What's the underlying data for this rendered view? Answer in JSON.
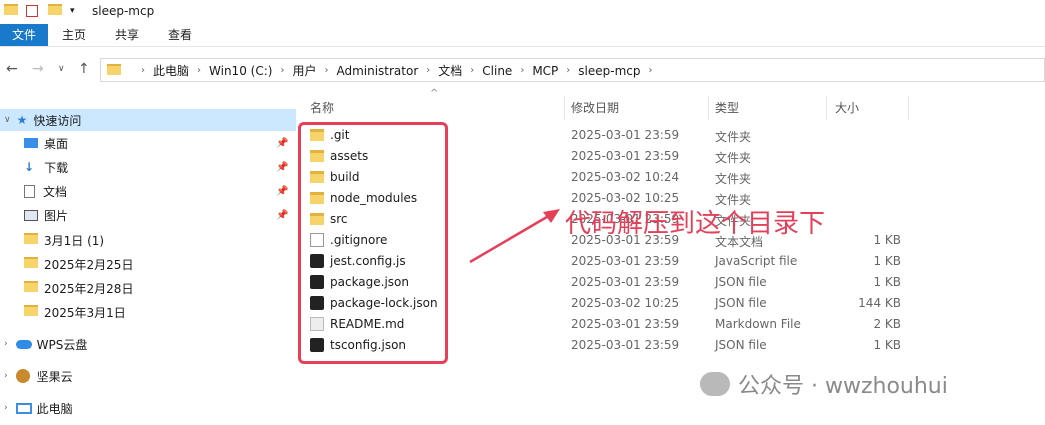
{
  "window": {
    "title": "sleep-mcp"
  },
  "ribbon": {
    "tabs": [
      "文件",
      "主页",
      "共享",
      "查看"
    ]
  },
  "address": {
    "crumbs": [
      "此电脑",
      "Win10 (C:)",
      "用户",
      "Administrator",
      "文档",
      "Cline",
      "MCP",
      "sleep-mcp"
    ]
  },
  "sidebar": {
    "items": [
      {
        "label": "快速访问",
        "icon": "star-icon"
      },
      {
        "label": "桌面",
        "icon": "desktop-icon",
        "pinned": true
      },
      {
        "label": "下载",
        "icon": "download-icon",
        "pinned": true
      },
      {
        "label": "文档",
        "icon": "document-icon",
        "pinned": true
      },
      {
        "label": "图片",
        "icon": "picture-icon",
        "pinned": true
      },
      {
        "label": "3月1日 (1)",
        "icon": "folder-icon"
      },
      {
        "label": "2025年2月25日",
        "icon": "folder-icon"
      },
      {
        "label": "2025年2月28日",
        "icon": "folder-icon"
      },
      {
        "label": "2025年3月1日",
        "icon": "folder-icon"
      },
      {
        "label": "WPS云盘",
        "icon": "cloud-icon"
      },
      {
        "label": "坚果云",
        "icon": "nut-icon"
      },
      {
        "label": "此电脑",
        "icon": "computer-icon"
      }
    ]
  },
  "columns": {
    "name": "名称",
    "date": "修改日期",
    "type": "类型",
    "size": "大小"
  },
  "files": [
    {
      "name": ".git",
      "date": "2025-03-01 23:59",
      "type": "文件夹",
      "size": "",
      "icon": "folder"
    },
    {
      "name": "assets",
      "date": "2025-03-01 23:59",
      "type": "文件夹",
      "size": "",
      "icon": "folder"
    },
    {
      "name": "build",
      "date": "2025-03-02 10:24",
      "type": "文件夹",
      "size": "",
      "icon": "folder"
    },
    {
      "name": "node_modules",
      "date": "2025-03-02 10:25",
      "type": "文件夹",
      "size": "",
      "icon": "folder"
    },
    {
      "name": "src",
      "date": "2025-03-01 23:59",
      "type": "文件夹",
      "size": "",
      "icon": "folder"
    },
    {
      "name": ".gitignore",
      "date": "2025-03-01 23:59",
      "type": "文本文档",
      "size": "1 KB",
      "icon": "doc"
    },
    {
      "name": "jest.config.js",
      "date": "2025-03-01 23:59",
      "type": "JavaScript file",
      "size": "1 KB",
      "icon": "dark"
    },
    {
      "name": "package.json",
      "date": "2025-03-01 23:59",
      "type": "JSON file",
      "size": "1 KB",
      "icon": "dark"
    },
    {
      "name": "package-lock.json",
      "date": "2025-03-02 10:25",
      "type": "JSON file",
      "size": "144 KB",
      "icon": "dark"
    },
    {
      "name": "README.md",
      "date": "2025-03-01 23:59",
      "type": "Markdown File",
      "size": "2 KB",
      "icon": "md"
    },
    {
      "name": "tsconfig.json",
      "date": "2025-03-01 23:59",
      "type": "JSON file",
      "size": "1 KB",
      "icon": "dark"
    }
  ],
  "annotation": {
    "text": "代码解压到这个目录下",
    "color": "#e4405a"
  },
  "watermark": {
    "text": "公众号 · wwzhouhui"
  }
}
